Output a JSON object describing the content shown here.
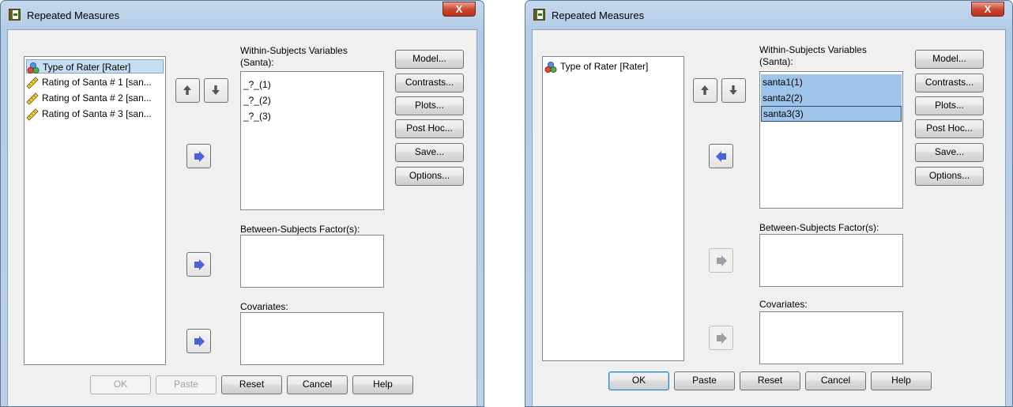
{
  "dialogs": [
    {
      "title": "Repeated Measures",
      "close_label": "X",
      "source_vars": [
        "Type of Rater [Rater]",
        "Rating of Santa # 1 [san...",
        "Rating of Santa # 2 [san...",
        "Rating of Santa # 3 [san..."
      ],
      "source_icons": [
        "nominal-icon",
        "scale-icon",
        "scale-icon",
        "scale-icon"
      ],
      "within_label_1": "Within-Subjects Variables",
      "within_label_2": "(Santa):",
      "within_items": [
        "_?_(1)",
        "_?_(2)",
        "_?_(3)"
      ],
      "between_label": "Between-Subjects Factor(s):",
      "covariates_label": "Covariates:",
      "side_buttons": [
        "Model...",
        "Contrasts...",
        "Plots...",
        "Post Hoc...",
        "Save...",
        "Options..."
      ],
      "bottom_buttons": [
        "OK",
        "Paste",
        "Reset",
        "Cancel",
        "Help"
      ]
    },
    {
      "title": "Repeated Measures",
      "close_label": "X",
      "source_vars": [
        "Type of Rater [Rater]"
      ],
      "source_icons": [
        "nominal-icon"
      ],
      "within_label_1": "Within-Subjects Variables",
      "within_label_2": "(Santa):",
      "within_items": [
        "santa1(1)",
        "santa2(2)",
        "santa3(3)"
      ],
      "between_label": "Between-Subjects Factor(s):",
      "covariates_label": "Covariates:",
      "side_buttons": [
        "Model...",
        "Contrasts...",
        "Plots...",
        "Post Hoc...",
        "Save...",
        "Options..."
      ],
      "bottom_buttons": [
        "OK",
        "Paste",
        "Reset",
        "Cancel",
        "Help"
      ]
    }
  ],
  "colors": {
    "selection": "#9fc4ea",
    "arrow_active": "#4b63d6",
    "arrow_disabled": "#9aa0a8"
  }
}
